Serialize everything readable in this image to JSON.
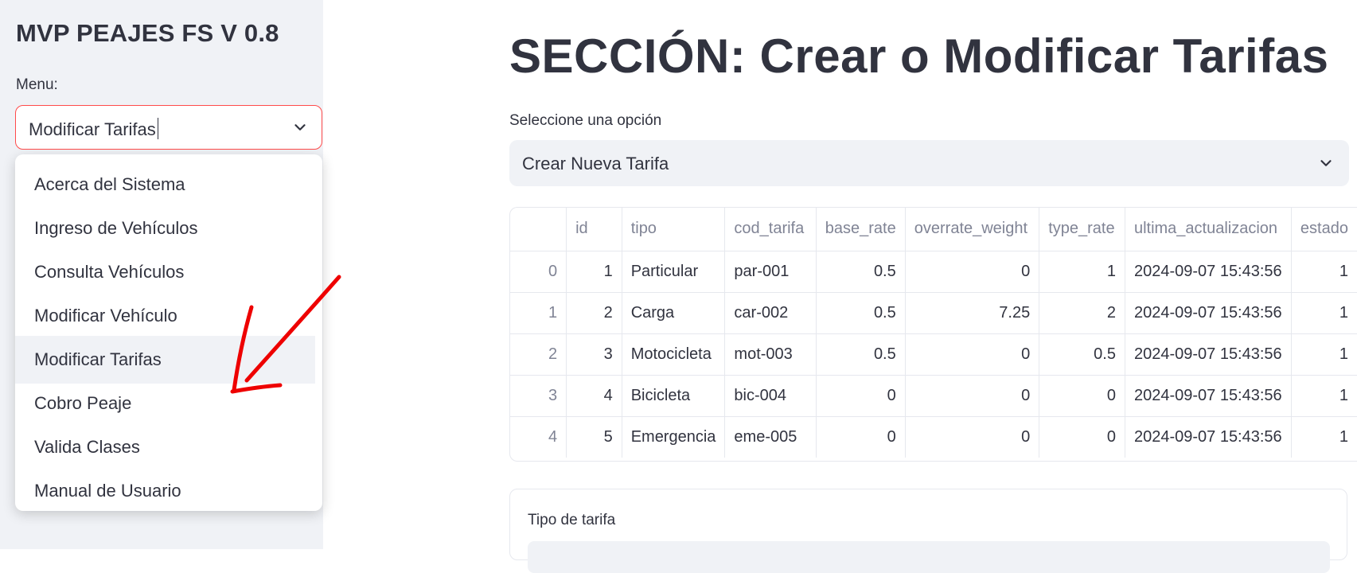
{
  "sidebar": {
    "app_title": "MVP PEAJES FS V 0.8",
    "menu_label": "Menu:",
    "menu_value": "Modificar Tarifas",
    "menu_items": [
      "Acerca del Sistema",
      "Ingreso de Vehículos",
      "Consulta Vehículos",
      "Modificar Vehículo",
      "Modificar Tarifas",
      "Cobro Peaje",
      "Valida Clases",
      "Manual de Usuario"
    ],
    "selected_item": "Modificar Tarifas"
  },
  "main": {
    "title": "SECCIÓN: Crear o Modificar Tarifas",
    "option_label": "Seleccione una opción",
    "option_value": "Crear Nueva Tarifa",
    "table": {
      "columns": [
        "",
        "id",
        "tipo",
        "cod_tarifa",
        "base_rate",
        "overrate_weight",
        "type_rate",
        "ultima_actualizacion",
        "estado"
      ],
      "rows": [
        [
          "0",
          "1",
          "Particular",
          "par-001",
          "0.5",
          "0",
          "1",
          "2024-09-07 15:43:56",
          "1"
        ],
        [
          "1",
          "2",
          "Carga",
          "car-002",
          "0.5",
          "7.25",
          "2",
          "2024-09-07 15:43:56",
          "1"
        ],
        [
          "2",
          "3",
          "Motocicleta",
          "mot-003",
          "0.5",
          "0",
          "0.5",
          "2024-09-07 15:43:56",
          "1"
        ],
        [
          "3",
          "4",
          "Bicicleta",
          "bic-004",
          "0",
          "0",
          "0",
          "2024-09-07 15:43:56",
          "1"
        ],
        [
          "4",
          "5",
          "Emergencia",
          "eme-005",
          "0",
          "0",
          "0",
          "2024-09-07 15:43:56",
          "1"
        ]
      ]
    },
    "form": {
      "tipo_label": "Tipo de tarifa"
    }
  },
  "colors": {
    "accent_red": "#ff4b4b",
    "annotation_red": "#ee0000",
    "sidebar_bg": "#f0f2f6",
    "text": "#31333f"
  },
  "icons": [
    "chevron-down-icon",
    "annotation-arrow"
  ]
}
